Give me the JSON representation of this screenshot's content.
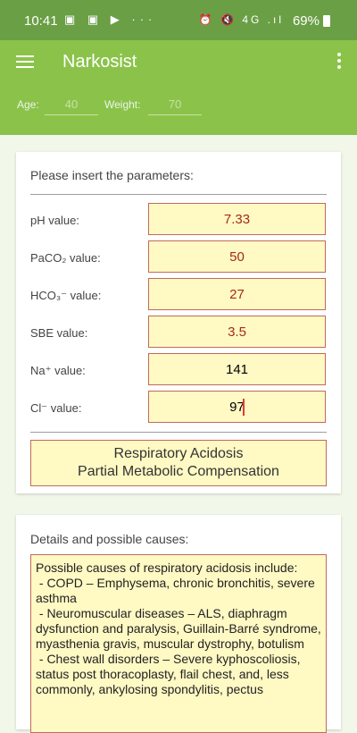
{
  "status_bar": {
    "time": "10:41",
    "notification_icons": "▣ ▣ ▶ ···",
    "system_icons": "⏰ 🔇 4G .ıl",
    "battery": "69%"
  },
  "app_bar": {
    "title": "Narkosist",
    "menu_icon": "hamburger-menu-icon",
    "overflow_icon": "more-vert-icon",
    "age_label": "Age:",
    "age_placeholder": "40",
    "weight_label": "Weight:",
    "weight_placeholder": "70"
  },
  "parameters_card": {
    "title": "Please insert the parameters:",
    "rows": [
      {
        "label": "pH value:",
        "value": "7.33"
      },
      {
        "label": "PaCO₂ value:",
        "value": "50"
      },
      {
        "label": "HCO₃⁻ value:",
        "value": "27"
      },
      {
        "label": "SBE value:",
        "value": "3.5"
      },
      {
        "label": "Na⁺ value:",
        "value": "141"
      },
      {
        "label": "Cl⁻ value:",
        "value": "97"
      }
    ],
    "result_line1": "Respiratory Acidosis",
    "result_line2": "Partial Metabolic Compensation"
  },
  "details_card": {
    "title": "Details and possible causes:",
    "text": "Possible causes of respiratory acidosis include:\n - COPD – Emphysema, chronic bronchitis, severe asthma\n - Neuromuscular diseases – ALS, diaphragm dysfunction and paralysis, Guillain-Barré syndrome, myasthenia gravis, muscular dystrophy, botulism\n - Chest wall disorders – Severe kyphoscoliosis, status post thoracoplasty, flail chest, and, less commonly, ankylosing spondylitis, pectus"
  },
  "colors": {
    "status_bar": "#6a9f45",
    "app_bar": "#8bc34a",
    "background": "#f1f8e9",
    "field_fill": "#fff9c4",
    "field_border": "#c06a5a",
    "value_text": "#a52a1a"
  }
}
